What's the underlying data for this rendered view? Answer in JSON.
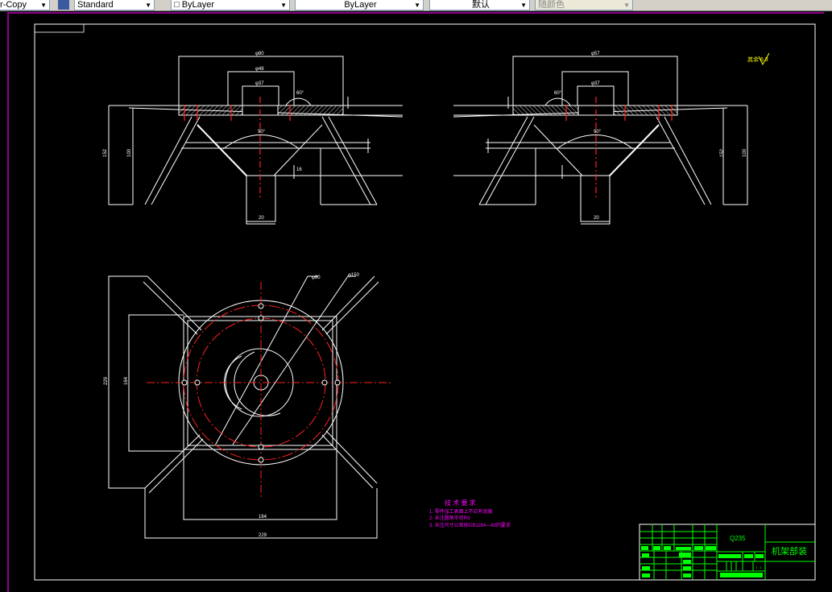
{
  "toolbar": {
    "text_style": "r-Copy",
    "dim_style": "Standard",
    "layer": "ByLayer",
    "linetype": "ByLayer",
    "lineweight": "默认",
    "plot_style": "随颜色"
  },
  "drawing": {
    "front_view_dims": [
      "φ80",
      "φ48",
      "φ37",
      "60°",
      "90°",
      "16",
      "20",
      "152",
      "100"
    ],
    "side_view_dims": [
      "φ57",
      "φ37",
      "60°",
      "90°",
      "20",
      "152",
      "100"
    ],
    "plan_view_dims": [
      "φ80",
      "φ150",
      "229",
      "164",
      "164",
      "229"
    ],
    "surface_finish": "其余 6.3",
    "tech_requirements": {
      "title": "技 术 要 求",
      "items": [
        "1. 零件加工表面上不应有划痕",
        "2. 未注圆角半径R3",
        "3. 未注尺寸公差按GB1184—80的要求"
      ]
    },
    "title_block": {
      "material": "Q235",
      "name": "机架部装",
      "scale": "1 : 1"
    }
  },
  "colors": {
    "line": "#ffffff",
    "center": "#ff2020",
    "text_notes": "#ff00ff",
    "title_block": "#00ff00",
    "frame": "#ff00ff"
  }
}
